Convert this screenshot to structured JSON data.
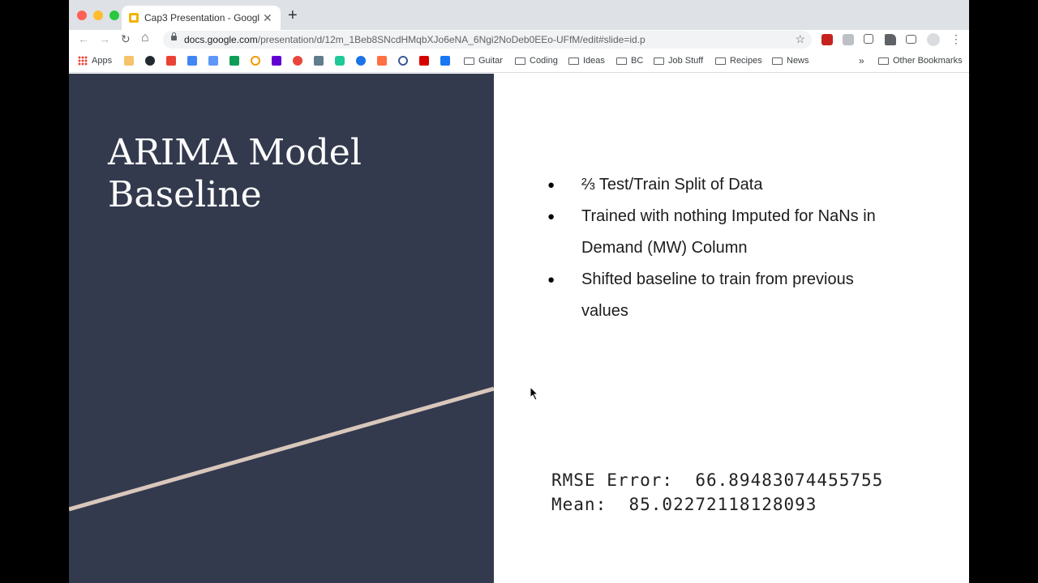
{
  "browser": {
    "tab_title": "Cap3 Presentation - Google Sl",
    "url_host": "docs.google.com",
    "url_path": "/presentation/d/12m_1Beb8SNcdHMqbXJo6eNA_6Ngi2NoDeb0EEo-UFfM/edit#slide=id.p",
    "close_glyph": "✕",
    "new_tab_glyph": "+",
    "back_glyph": "←",
    "forward_glyph": "→",
    "reload_glyph": "↻",
    "home_glyph": "⌂",
    "star_glyph": "☆",
    "menu_glyph": "⋮"
  },
  "bookmarks": {
    "apps": "Apps",
    "folders": [
      "Guitar",
      "Coding",
      "Ideas",
      "BC",
      "Job Stuff",
      "Recipes",
      "News"
    ],
    "more": "»",
    "other": "Other Bookmarks"
  },
  "slide": {
    "title_line1": "ARIMA Model",
    "title_line2": "Baseline",
    "bullets": [
      "⅔ Test/Train Split of Data",
      "Trained with nothing Imputed for NaNs in Demand (MW) Column",
      "Shifted baseline to train from previous values"
    ],
    "rmse_line": "RMSE Error:  66.89483074455755",
    "mean_line": "Mean:  85.02272118128093"
  },
  "colors": {
    "left_panel": "#333a4e",
    "stripe": "#d9c7bb",
    "traffic": [
      "#ff5f57",
      "#febc2e",
      "#28c840"
    ]
  }
}
